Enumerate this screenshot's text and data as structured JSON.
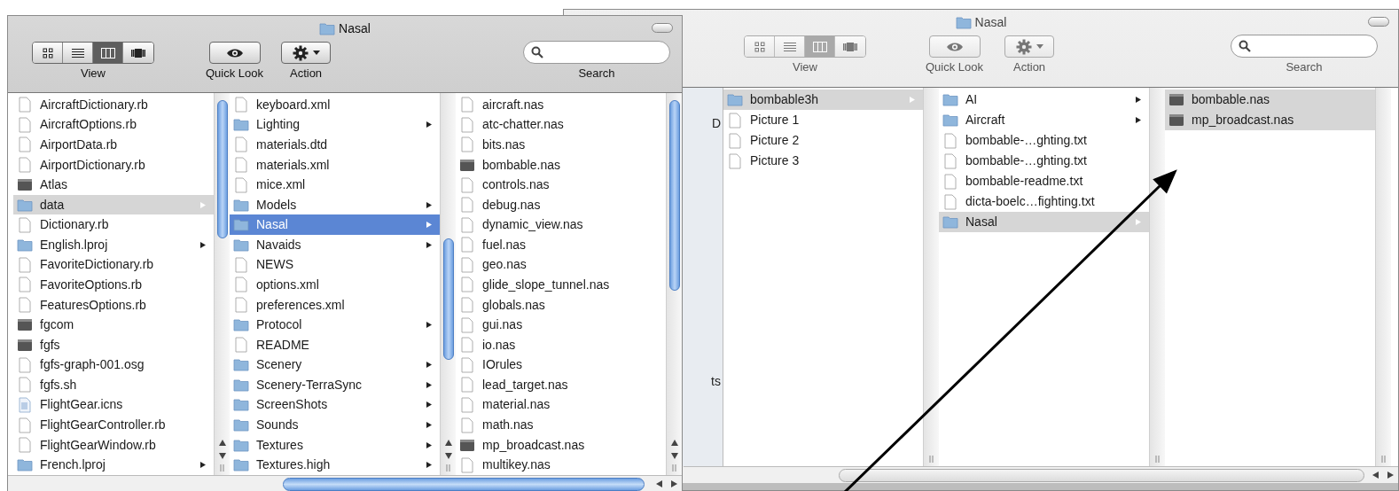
{
  "windows": [
    {
      "title": "Nasal",
      "active": true,
      "toolbar": {
        "view_label": "View",
        "quick_look_label": "Quick Look",
        "action_label": "Action",
        "search_label": "Search",
        "view_buttons": [
          {
            "kind": "icons",
            "selected": false
          },
          {
            "kind": "list",
            "selected": false
          },
          {
            "kind": "columns",
            "selected": true
          },
          {
            "kind": "coverflow",
            "selected": false
          }
        ]
      },
      "columns": [
        {
          "items": [
            {
              "name": "AircraftDictionary.rb",
              "kind": "document",
              "has_children": false,
              "selected": false,
              "focused": false
            },
            {
              "name": "AircraftOptions.rb",
              "kind": "document",
              "has_children": false,
              "selected": false,
              "focused": false
            },
            {
              "name": "AirportData.rb",
              "kind": "document",
              "has_children": false,
              "selected": false,
              "focused": false
            },
            {
              "name": "AirportDictionary.rb",
              "kind": "document",
              "has_children": false,
              "selected": false,
              "focused": false
            },
            {
              "name": "Atlas",
              "kind": "executable",
              "has_children": false,
              "selected": false,
              "focused": false
            },
            {
              "name": "data",
              "kind": "folder",
              "has_children": true,
              "selected": true,
              "focused": false
            },
            {
              "name": "Dictionary.rb",
              "kind": "document",
              "has_children": false,
              "selected": false,
              "focused": false
            },
            {
              "name": "English.lproj",
              "kind": "folder",
              "has_children": true,
              "selected": false,
              "focused": false
            },
            {
              "name": "FavoriteDictionary.rb",
              "kind": "document",
              "has_children": false,
              "selected": false,
              "focused": false
            },
            {
              "name": "FavoriteOptions.rb",
              "kind": "document",
              "has_children": false,
              "selected": false,
              "focused": false
            },
            {
              "name": "FeaturesOptions.rb",
              "kind": "document",
              "has_children": false,
              "selected": false,
              "focused": false
            },
            {
              "name": "fgcom",
              "kind": "executable",
              "has_children": false,
              "selected": false,
              "focused": false
            },
            {
              "name": "fgfs",
              "kind": "executable",
              "has_children": false,
              "selected": false,
              "focused": false
            },
            {
              "name": "fgfs-graph-001.osg",
              "kind": "document",
              "has_children": false,
              "selected": false,
              "focused": false
            },
            {
              "name": "fgfs.sh",
              "kind": "document",
              "has_children": false,
              "selected": false,
              "focused": false
            },
            {
              "name": "FlightGear.icns",
              "kind": "icon_file",
              "has_children": false,
              "selected": false,
              "focused": false
            },
            {
              "name": "FlightGearController.rb",
              "kind": "document",
              "has_children": false,
              "selected": false,
              "focused": false
            },
            {
              "name": "FlightGearWindow.rb",
              "kind": "document",
              "has_children": false,
              "selected": false,
              "focused": false
            },
            {
              "name": "French.lproj",
              "kind": "folder",
              "has_children": true,
              "selected": false,
              "focused": false
            }
          ]
        },
        {
          "items": [
            {
              "name": "keyboard.xml",
              "kind": "document",
              "has_children": false,
              "selected": false,
              "focused": false
            },
            {
              "name": "Lighting",
              "kind": "folder",
              "has_children": true,
              "selected": false,
              "focused": false
            },
            {
              "name": "materials.dtd",
              "kind": "document",
              "has_children": false,
              "selected": false,
              "focused": false
            },
            {
              "name": "materials.xml",
              "kind": "document",
              "has_children": false,
              "selected": false,
              "focused": false
            },
            {
              "name": "mice.xml",
              "kind": "document",
              "has_children": false,
              "selected": false,
              "focused": false
            },
            {
              "name": "Models",
              "kind": "folder",
              "has_children": true,
              "selected": false,
              "focused": false
            },
            {
              "name": "Nasal",
              "kind": "folder",
              "has_children": true,
              "selected": true,
              "focused": true
            },
            {
              "name": "Navaids",
              "kind": "folder",
              "has_children": true,
              "selected": false,
              "focused": false
            },
            {
              "name": "NEWS",
              "kind": "document",
              "has_children": false,
              "selected": false,
              "focused": false
            },
            {
              "name": "options.xml",
              "kind": "document",
              "has_children": false,
              "selected": false,
              "focused": false
            },
            {
              "name": "preferences.xml",
              "kind": "document",
              "has_children": false,
              "selected": false,
              "focused": false
            },
            {
              "name": "Protocol",
              "kind": "folder",
              "has_children": true,
              "selected": false,
              "focused": false
            },
            {
              "name": "README",
              "kind": "document",
              "has_children": false,
              "selected": false,
              "focused": false
            },
            {
              "name": "Scenery",
              "kind": "folder",
              "has_children": true,
              "selected": false,
              "focused": false
            },
            {
              "name": "Scenery-TerraSync",
              "kind": "folder",
              "has_children": true,
              "selected": false,
              "focused": false
            },
            {
              "name": "ScreenShots",
              "kind": "folder",
              "has_children": true,
              "selected": false,
              "focused": false
            },
            {
              "name": "Sounds",
              "kind": "folder",
              "has_children": true,
              "selected": false,
              "focused": false
            },
            {
              "name": "Textures",
              "kind": "folder",
              "has_children": true,
              "selected": false,
              "focused": false
            },
            {
              "name": "Textures.high",
              "kind": "folder",
              "has_children": true,
              "selected": false,
              "focused": false
            }
          ]
        },
        {
          "items": [
            {
              "name": "aircraft.nas",
              "kind": "document",
              "has_children": false,
              "selected": false,
              "focused": false
            },
            {
              "name": "atc-chatter.nas",
              "kind": "document",
              "has_children": false,
              "selected": false,
              "focused": false
            },
            {
              "name": "bits.nas",
              "kind": "document",
              "has_children": false,
              "selected": false,
              "focused": false
            },
            {
              "name": "bombable.nas",
              "kind": "executable",
              "has_children": false,
              "selected": false,
              "focused": false
            },
            {
              "name": "controls.nas",
              "kind": "document",
              "has_children": false,
              "selected": false,
              "focused": false
            },
            {
              "name": "debug.nas",
              "kind": "document",
              "has_children": false,
              "selected": false,
              "focused": false
            },
            {
              "name": "dynamic_view.nas",
              "kind": "document",
              "has_children": false,
              "selected": false,
              "focused": false
            },
            {
              "name": "fuel.nas",
              "kind": "document",
              "has_children": false,
              "selected": false,
              "focused": false
            },
            {
              "name": "geo.nas",
              "kind": "document",
              "has_children": false,
              "selected": false,
              "focused": false
            },
            {
              "name": "glide_slope_tunnel.nas",
              "kind": "document",
              "has_children": false,
              "selected": false,
              "focused": false
            },
            {
              "name": "globals.nas",
              "kind": "document",
              "has_children": false,
              "selected": false,
              "focused": false
            },
            {
              "name": "gui.nas",
              "kind": "document",
              "has_children": false,
              "selected": false,
              "focused": false
            },
            {
              "name": "io.nas",
              "kind": "document",
              "has_children": false,
              "selected": false,
              "focused": false
            },
            {
              "name": "IOrules",
              "kind": "document",
              "has_children": false,
              "selected": false,
              "focused": false
            },
            {
              "name": "lead_target.nas",
              "kind": "document",
              "has_children": false,
              "selected": false,
              "focused": false
            },
            {
              "name": "material.nas",
              "kind": "document",
              "has_children": false,
              "selected": false,
              "focused": false
            },
            {
              "name": "math.nas",
              "kind": "document",
              "has_children": false,
              "selected": false,
              "focused": false
            },
            {
              "name": "mp_broadcast.nas",
              "kind": "executable",
              "has_children": false,
              "selected": false,
              "focused": false
            },
            {
              "name": "multikey.nas",
              "kind": "document",
              "has_children": false,
              "selected": false,
              "focused": false
            }
          ]
        }
      ]
    },
    {
      "title": "Nasal",
      "active": false,
      "toolbar": {
        "view_label": "View",
        "quick_look_label": "Quick Look",
        "action_label": "Action",
        "search_label": "Search",
        "view_buttons": [
          {
            "kind": "icons",
            "selected": false
          },
          {
            "kind": "list",
            "selected": false
          },
          {
            "kind": "columns",
            "selected": true
          },
          {
            "kind": "coverflow",
            "selected": false
          }
        ]
      },
      "sidebar_fragments": [
        "D",
        "ts"
      ],
      "columns": [
        {
          "items": [
            {
              "name": "bombable3h",
              "kind": "folder",
              "has_children": true,
              "selected": true,
              "focused": false
            },
            {
              "name": "Picture 1",
              "kind": "document",
              "has_children": false,
              "selected": false,
              "focused": false
            },
            {
              "name": "Picture 2",
              "kind": "document",
              "has_children": false,
              "selected": false,
              "focused": false
            },
            {
              "name": "Picture 3",
              "kind": "document",
              "has_children": false,
              "selected": false,
              "focused": false
            }
          ]
        },
        {
          "items": [
            {
              "name": "AI",
              "kind": "folder",
              "has_children": true,
              "selected": false,
              "focused": false
            },
            {
              "name": "Aircraft",
              "kind": "folder",
              "has_children": true,
              "selected": false,
              "focused": false
            },
            {
              "name": "bombable-…ghting.txt",
              "kind": "document",
              "has_children": false,
              "selected": false,
              "focused": false
            },
            {
              "name": "bombable-…ghting.txt",
              "kind": "document",
              "has_children": false,
              "selected": false,
              "focused": false
            },
            {
              "name": "bombable-readme.txt",
              "kind": "document",
              "has_children": false,
              "selected": false,
              "focused": false
            },
            {
              "name": "dicta-boelc…fighting.txt",
              "kind": "document",
              "has_children": false,
              "selected": false,
              "focused": false
            },
            {
              "name": "Nasal",
              "kind": "folder",
              "has_children": true,
              "selected": true,
              "focused": false
            }
          ]
        },
        {
          "items": [
            {
              "name": "bombable.nas",
              "kind": "executable",
              "has_children": false,
              "selected": true,
              "focused": false
            },
            {
              "name": "mp_broadcast.nas",
              "kind": "executable",
              "has_children": false,
              "selected": true,
              "focused": false
            }
          ]
        }
      ]
    }
  ]
}
